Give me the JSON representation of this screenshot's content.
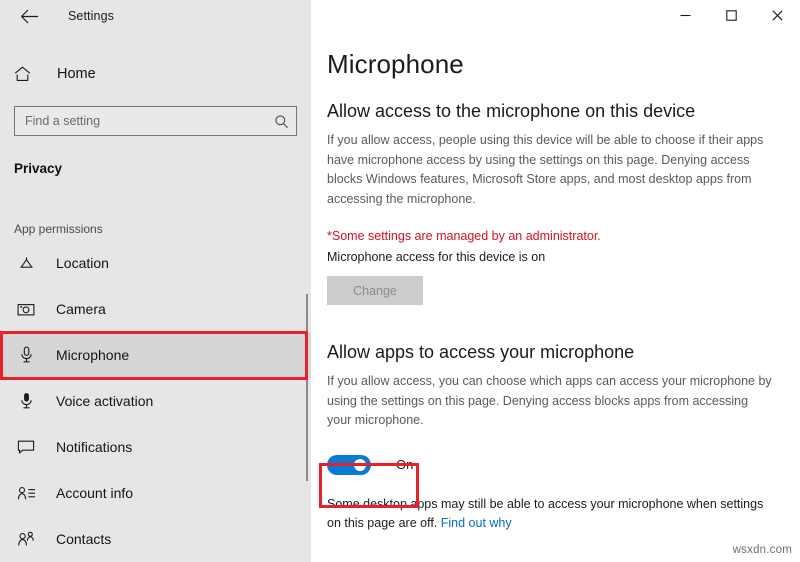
{
  "window": {
    "title": "Settings",
    "back_icon": "back-arrow-icon",
    "controls": {
      "minimize": "–",
      "maximize": "□",
      "close": "✕"
    }
  },
  "sidebar": {
    "home_label": "Home",
    "home_icon": "home-icon",
    "search": {
      "placeholder": "Find a setting",
      "value": "",
      "icon": "search-icon"
    },
    "section_title": "Privacy",
    "group_label": "App permissions",
    "items": [
      {
        "label": "Location",
        "icon": "location-icon",
        "selected": false
      },
      {
        "label": "Camera",
        "icon": "camera-icon",
        "selected": false
      },
      {
        "label": "Microphone",
        "icon": "microphone-icon",
        "selected": true
      },
      {
        "label": "Voice activation",
        "icon": "voice-activation-icon",
        "selected": false
      },
      {
        "label": "Notifications",
        "icon": "notifications-icon",
        "selected": false
      },
      {
        "label": "Account info",
        "icon": "account-info-icon",
        "selected": false
      },
      {
        "label": "Contacts",
        "icon": "contacts-icon",
        "selected": false
      }
    ]
  },
  "main": {
    "page_title": "Microphone",
    "device_section": {
      "heading": "Allow access to the microphone on this device",
      "body": "If you allow access, people using this device will be able to choose if their apps have microphone access by using the settings on this page. Denying access blocks Windows features, Microsoft Store apps, and most desktop apps from accessing the microphone.",
      "admin_note": "*Some settings are managed by an administrator.",
      "status": "Microphone access for this device is on",
      "change_button": "Change"
    },
    "apps_section": {
      "heading": "Allow apps to access your microphone",
      "body": "If you allow access, you can choose which apps can access your microphone by using the settings on this page. Denying access blocks apps from accessing your microphone.",
      "toggle_state": "On",
      "footer_text": "Some desktop apps may still be able to access your microphone when settings on this page are off. ",
      "footer_link": "Find out why"
    }
  },
  "highlights": {
    "accent_color": "#e8202a",
    "toggle_on_color": "#0a7bd4"
  },
  "watermark": "wsxdn.com"
}
